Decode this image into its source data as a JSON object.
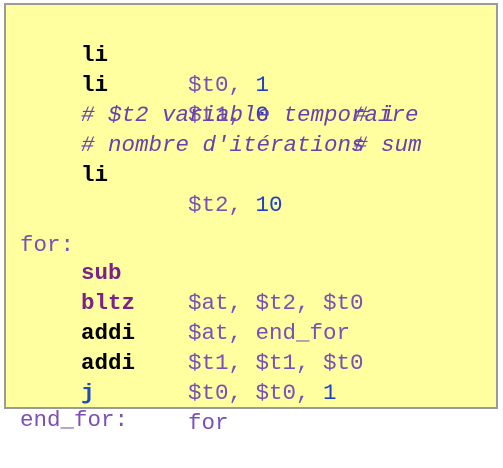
{
  "lines": [
    {
      "mnemonic": "li",
      "operands": "$t0, ",
      "imm": "1",
      "comment": "# i"
    },
    {
      "mnemonic": "li",
      "operands": "$t1, ",
      "imm": "0",
      "comment": "# sum"
    },
    {
      "comment": "# $t2 variable temporaire"
    },
    {
      "comment": "# nombre d'itérations"
    },
    {
      "mnemonic": "li",
      "operands": "$t2, ",
      "imm": "10"
    },
    {
      "label": "for:"
    },
    {
      "mnemonic": "sub",
      "operands": "$at, $t2, $t0"
    },
    {
      "mnemonic": "bltz",
      "operands": "$at, end_for"
    },
    {
      "mnemonic": "addi",
      "operands": "$t1, $t1, $t0"
    },
    {
      "mnemonic": "addi",
      "operands": "$t0, $t0, ",
      "imm": "1"
    },
    {
      "mnemonic": "j",
      "operands": "for"
    },
    {
      "label": "end_for:"
    }
  ],
  "colors": {
    "background": "#ffffa0",
    "border": "#9a9a9a",
    "register_text": "#7a4fb8",
    "immediate": "#1f3fd0",
    "mnemonic_default": "#000000",
    "mnemonic_sub_bltz": "#7b2187",
    "mnemonic_j": "#1f4fb4"
  }
}
